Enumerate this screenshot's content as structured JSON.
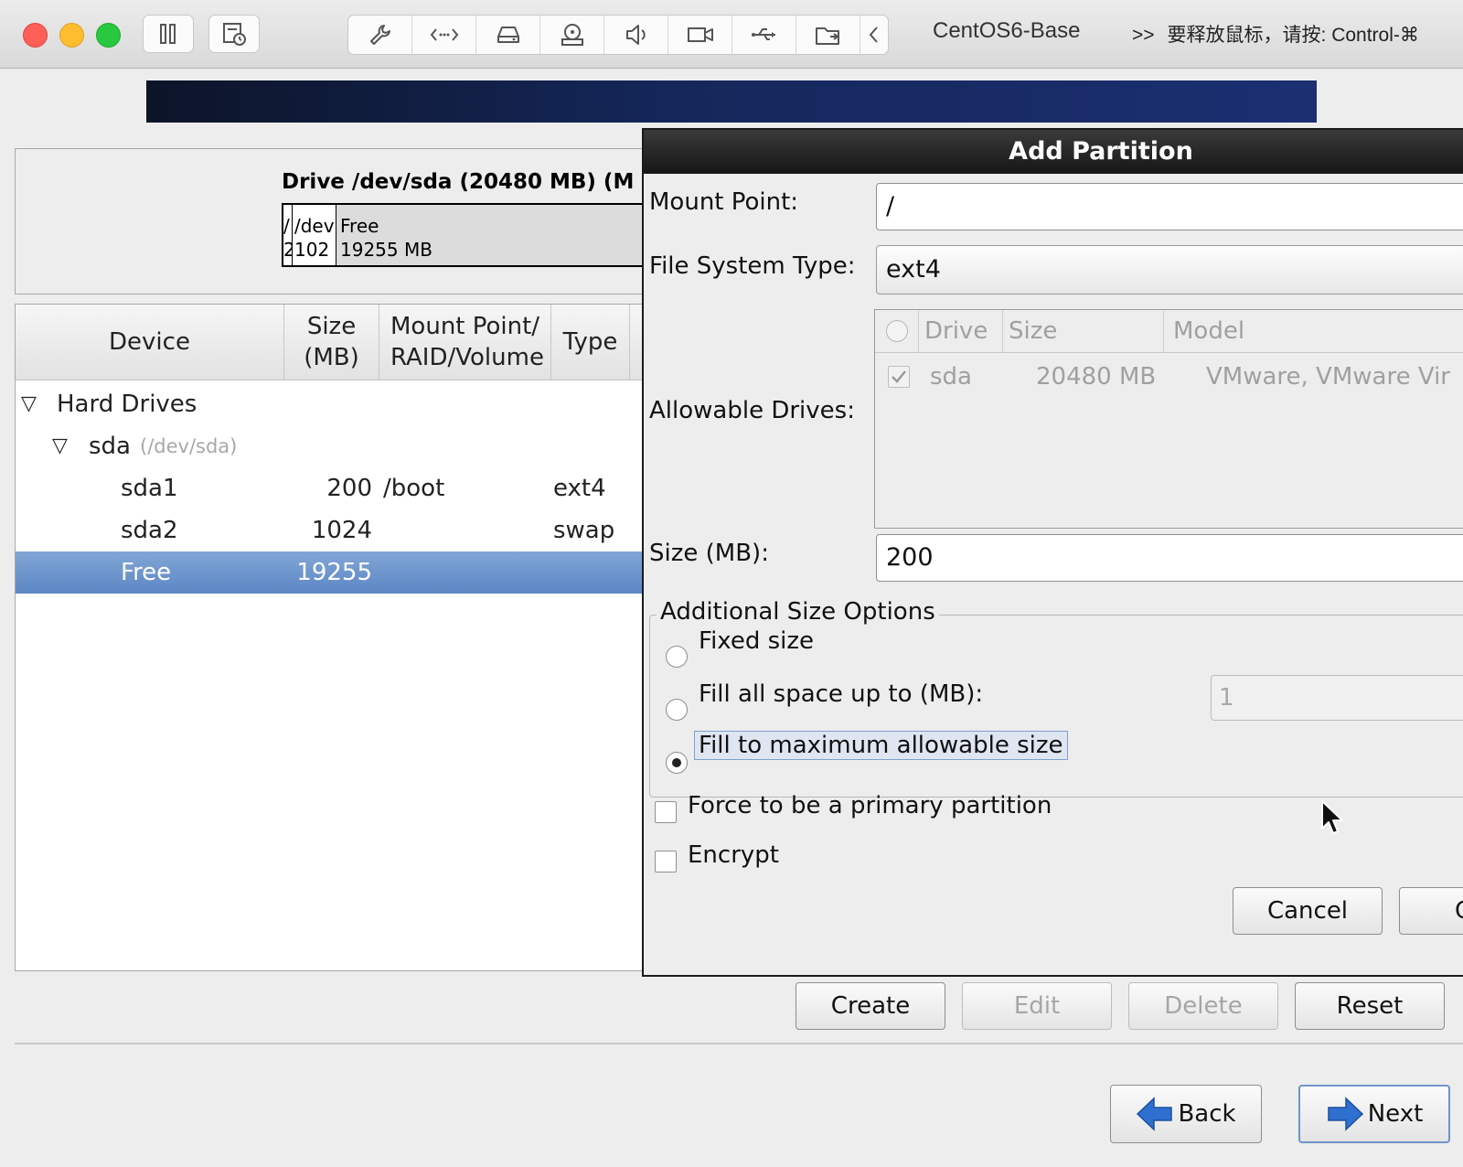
{
  "vm": {
    "title": "CentOS6-Base",
    "release_hint": "要释放鼠标，请按: Control-⌘",
    "chevrons": ">>"
  },
  "drive": {
    "title": "Drive /dev/sda (20480 MB) (M",
    "segments": [
      {
        "top": "/",
        "bottom": "2"
      },
      {
        "top": "/dev",
        "bottom": "102"
      },
      {
        "top": "Free",
        "bottom": "19255 MB"
      }
    ]
  },
  "tree": {
    "headers": {
      "device": "Device",
      "size_l1": "Size",
      "size_l2": "(MB)",
      "mount_l1": "Mount Point/",
      "mount_l2": "RAID/Volume",
      "type": "Type"
    },
    "group": "Hard Drives",
    "disk": {
      "name": "sda",
      "path": "(/dev/sda)"
    },
    "rows": [
      {
        "device": "sda1",
        "size": "200",
        "mount": "/boot",
        "type": "ext4"
      },
      {
        "device": "sda2",
        "size": "1024",
        "mount": "",
        "type": "swap"
      },
      {
        "device": "Free",
        "size": "19255",
        "mount": "",
        "type": ""
      }
    ]
  },
  "dialog": {
    "title": "Add Partition",
    "mount_label": "Mount Point:",
    "mount_value": "/",
    "fs_label": "File System Type:",
    "fs_value": "ext4",
    "drives_label": "Allowable Drives:",
    "drives_headers": {
      "drive": "Drive",
      "size": "Size",
      "model": "Model"
    },
    "drive_row": {
      "drive": "sda",
      "size": "20480 MB",
      "model": "VMware, VMware Vir"
    },
    "size_label": "Size (MB):",
    "size_value": "200",
    "size_options_title": "Additional Size Options",
    "opt_fixed": "Fixed size",
    "opt_fill_up": "Fill all space up to (MB):",
    "opt_fill_up_value": "1",
    "opt_fill_max": "Fill to maximum allowable size",
    "selected_option": "fill_max",
    "primary_label": "Force to be a primary partition",
    "encrypt_label": "Encrypt",
    "cancel_label": "Cancel",
    "ok_label_partial": "C"
  },
  "actions": {
    "create": "Create",
    "edit": "Edit",
    "delete": "Delete",
    "reset": "Reset"
  },
  "nav": {
    "back": "Back",
    "next": "Next"
  },
  "colors": {
    "selection": "#6a93cc",
    "arrow_blue": "#2f6fd0",
    "traffic_red": "#fe5f57",
    "traffic_yellow": "#febc2e",
    "traffic_green": "#28c840"
  }
}
